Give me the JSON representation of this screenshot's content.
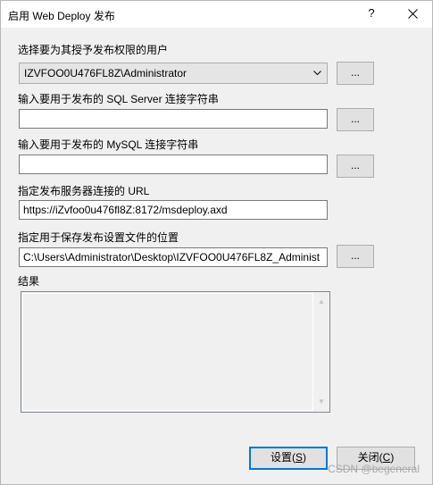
{
  "dialog": {
    "title": "启用 Web Deploy 发布",
    "help_label": "?",
    "close_label": "close"
  },
  "user_section": {
    "label": "选择要为其授予发布权限的用户",
    "selected_value": "IZVFOO0U476FL8Z\\Administrator",
    "browse_label": "..."
  },
  "sql_section": {
    "label": "输入要用于发布的 SQL Server 连接字符串",
    "value": "",
    "browse_label": "..."
  },
  "mysql_section": {
    "label": "输入要用于发布的 MySQL 连接字符串",
    "value": "",
    "browse_label": "..."
  },
  "url_section": {
    "label": "指定发布服务器连接的 URL",
    "value": "https://iZvfoo0u476fl8Z:8172/msdeploy.axd"
  },
  "save_location_section": {
    "label": "指定用于保存发布设置文件的位置",
    "value": "C:\\Users\\Administrator\\Desktop\\IZVFOO0U476FL8Z_Administ",
    "browse_label": "..."
  },
  "results_section": {
    "label": "结果"
  },
  "buttons": {
    "setup_label": "设置(",
    "setup_accel": "S",
    "setup_suffix": ")",
    "close_label": "关闭(",
    "close_accel": "C",
    "close_suffix": ")"
  },
  "watermark": "CSDN @begeneral",
  "colors": {
    "window_bg": "#f0f0f0",
    "titlebar_bg": "#ffffff",
    "default_button_border": "#0078d7"
  }
}
